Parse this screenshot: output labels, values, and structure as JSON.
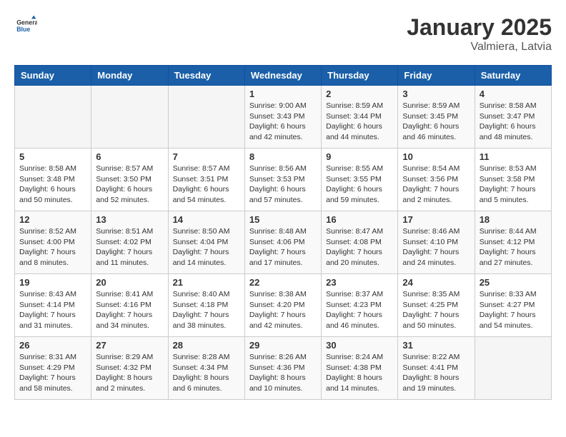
{
  "header": {
    "logo_line1": "General",
    "logo_line2": "Blue",
    "month": "January 2025",
    "location": "Valmiera, Latvia"
  },
  "weekdays": [
    "Sunday",
    "Monday",
    "Tuesday",
    "Wednesday",
    "Thursday",
    "Friday",
    "Saturday"
  ],
  "weeks": [
    [
      {
        "day": "",
        "info": ""
      },
      {
        "day": "",
        "info": ""
      },
      {
        "day": "",
        "info": ""
      },
      {
        "day": "1",
        "info": "Sunrise: 9:00 AM\nSunset: 3:43 PM\nDaylight: 6 hours\nand 42 minutes."
      },
      {
        "day": "2",
        "info": "Sunrise: 8:59 AM\nSunset: 3:44 PM\nDaylight: 6 hours\nand 44 minutes."
      },
      {
        "day": "3",
        "info": "Sunrise: 8:59 AM\nSunset: 3:45 PM\nDaylight: 6 hours\nand 46 minutes."
      },
      {
        "day": "4",
        "info": "Sunrise: 8:58 AM\nSunset: 3:47 PM\nDaylight: 6 hours\nand 48 minutes."
      }
    ],
    [
      {
        "day": "5",
        "info": "Sunrise: 8:58 AM\nSunset: 3:48 PM\nDaylight: 6 hours\nand 50 minutes."
      },
      {
        "day": "6",
        "info": "Sunrise: 8:57 AM\nSunset: 3:50 PM\nDaylight: 6 hours\nand 52 minutes."
      },
      {
        "day": "7",
        "info": "Sunrise: 8:57 AM\nSunset: 3:51 PM\nDaylight: 6 hours\nand 54 minutes."
      },
      {
        "day": "8",
        "info": "Sunrise: 8:56 AM\nSunset: 3:53 PM\nDaylight: 6 hours\nand 57 minutes."
      },
      {
        "day": "9",
        "info": "Sunrise: 8:55 AM\nSunset: 3:55 PM\nDaylight: 6 hours\nand 59 minutes."
      },
      {
        "day": "10",
        "info": "Sunrise: 8:54 AM\nSunset: 3:56 PM\nDaylight: 7 hours\nand 2 minutes."
      },
      {
        "day": "11",
        "info": "Sunrise: 8:53 AM\nSunset: 3:58 PM\nDaylight: 7 hours\nand 5 minutes."
      }
    ],
    [
      {
        "day": "12",
        "info": "Sunrise: 8:52 AM\nSunset: 4:00 PM\nDaylight: 7 hours\nand 8 minutes."
      },
      {
        "day": "13",
        "info": "Sunrise: 8:51 AM\nSunset: 4:02 PM\nDaylight: 7 hours\nand 11 minutes."
      },
      {
        "day": "14",
        "info": "Sunrise: 8:50 AM\nSunset: 4:04 PM\nDaylight: 7 hours\nand 14 minutes."
      },
      {
        "day": "15",
        "info": "Sunrise: 8:48 AM\nSunset: 4:06 PM\nDaylight: 7 hours\nand 17 minutes."
      },
      {
        "day": "16",
        "info": "Sunrise: 8:47 AM\nSunset: 4:08 PM\nDaylight: 7 hours\nand 20 minutes."
      },
      {
        "day": "17",
        "info": "Sunrise: 8:46 AM\nSunset: 4:10 PM\nDaylight: 7 hours\nand 24 minutes."
      },
      {
        "day": "18",
        "info": "Sunrise: 8:44 AM\nSunset: 4:12 PM\nDaylight: 7 hours\nand 27 minutes."
      }
    ],
    [
      {
        "day": "19",
        "info": "Sunrise: 8:43 AM\nSunset: 4:14 PM\nDaylight: 7 hours\nand 31 minutes."
      },
      {
        "day": "20",
        "info": "Sunrise: 8:41 AM\nSunset: 4:16 PM\nDaylight: 7 hours\nand 34 minutes."
      },
      {
        "day": "21",
        "info": "Sunrise: 8:40 AM\nSunset: 4:18 PM\nDaylight: 7 hours\nand 38 minutes."
      },
      {
        "day": "22",
        "info": "Sunrise: 8:38 AM\nSunset: 4:20 PM\nDaylight: 7 hours\nand 42 minutes."
      },
      {
        "day": "23",
        "info": "Sunrise: 8:37 AM\nSunset: 4:23 PM\nDaylight: 7 hours\nand 46 minutes."
      },
      {
        "day": "24",
        "info": "Sunrise: 8:35 AM\nSunset: 4:25 PM\nDaylight: 7 hours\nand 50 minutes."
      },
      {
        "day": "25",
        "info": "Sunrise: 8:33 AM\nSunset: 4:27 PM\nDaylight: 7 hours\nand 54 minutes."
      }
    ],
    [
      {
        "day": "26",
        "info": "Sunrise: 8:31 AM\nSunset: 4:29 PM\nDaylight: 7 hours\nand 58 minutes."
      },
      {
        "day": "27",
        "info": "Sunrise: 8:29 AM\nSunset: 4:32 PM\nDaylight: 8 hours\nand 2 minutes."
      },
      {
        "day": "28",
        "info": "Sunrise: 8:28 AM\nSunset: 4:34 PM\nDaylight: 8 hours\nand 6 minutes."
      },
      {
        "day": "29",
        "info": "Sunrise: 8:26 AM\nSunset: 4:36 PM\nDaylight: 8 hours\nand 10 minutes."
      },
      {
        "day": "30",
        "info": "Sunrise: 8:24 AM\nSunset: 4:38 PM\nDaylight: 8 hours\nand 14 minutes."
      },
      {
        "day": "31",
        "info": "Sunrise: 8:22 AM\nSunset: 4:41 PM\nDaylight: 8 hours\nand 19 minutes."
      },
      {
        "day": "",
        "info": ""
      }
    ]
  ]
}
